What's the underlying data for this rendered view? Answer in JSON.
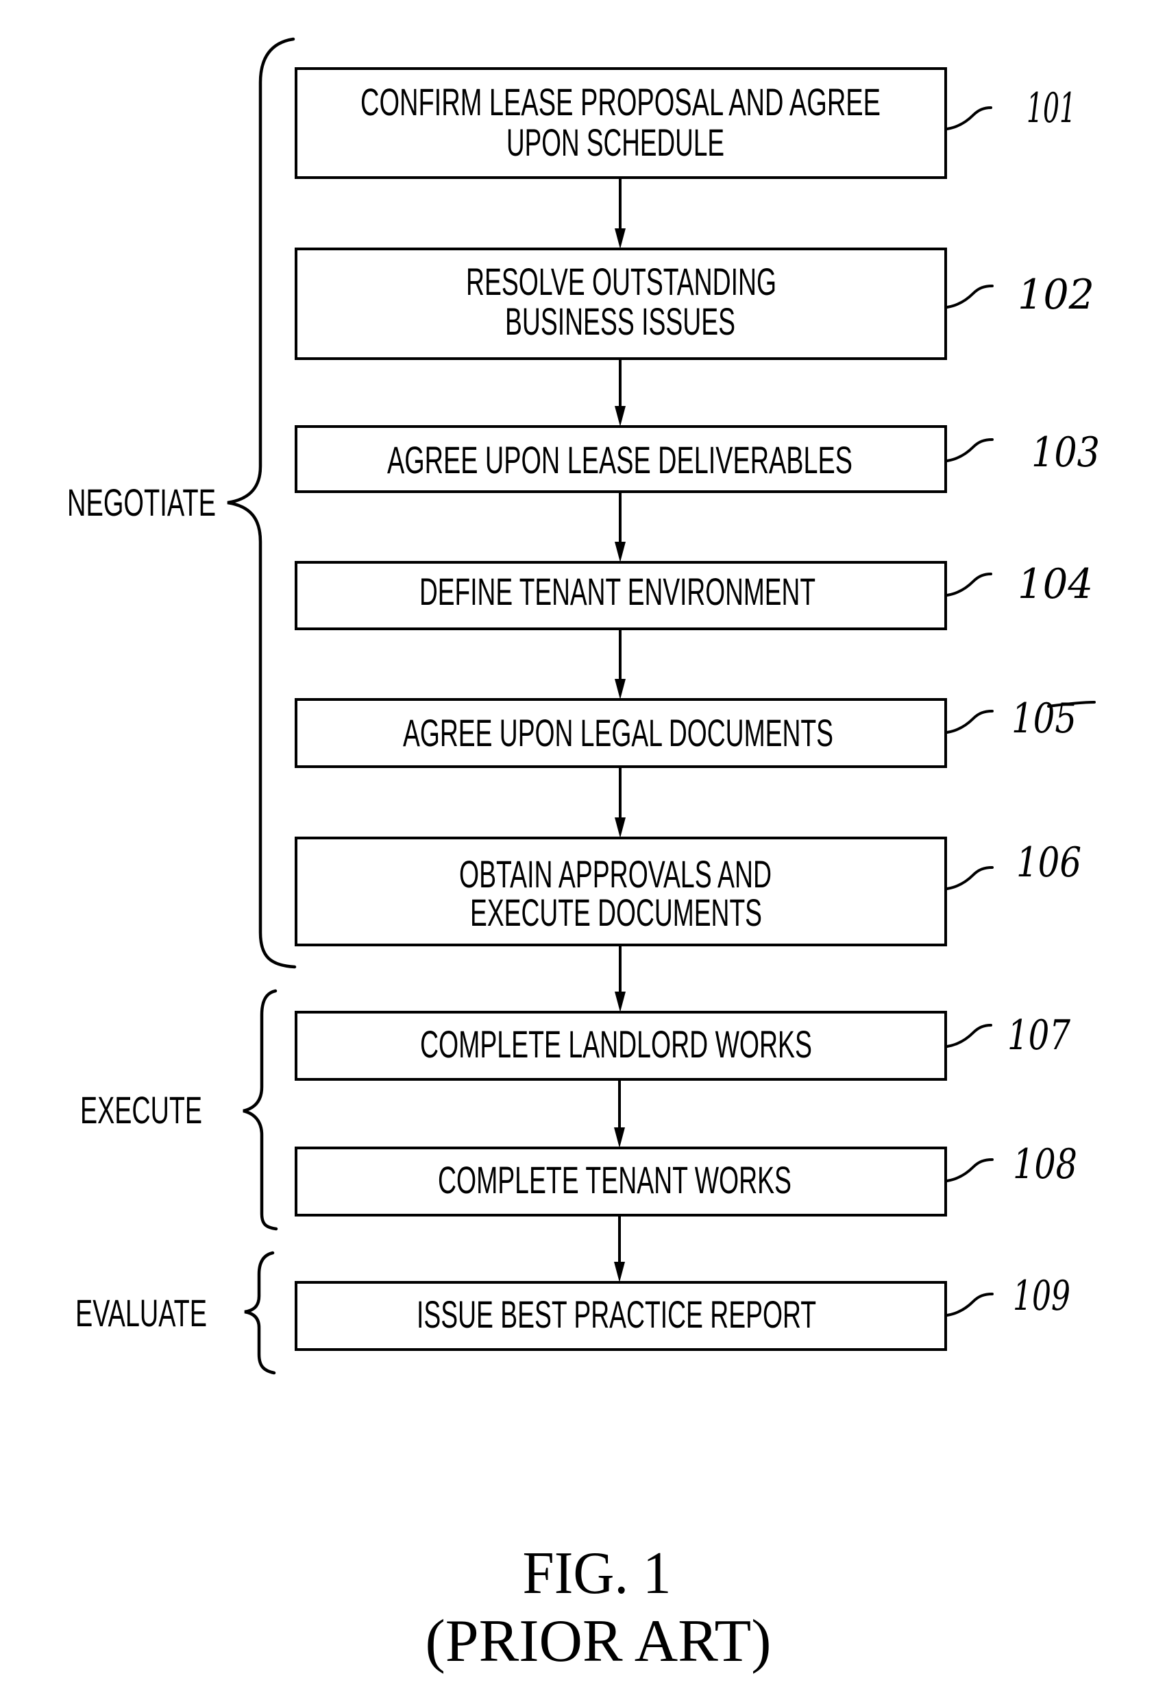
{
  "figure": {
    "caption": "FIG. 1",
    "subcaption": "(PRIOR ART)"
  },
  "phases": [
    {
      "label": "NEGOTIATE",
      "steps": [
        "101",
        "102",
        "103",
        "104",
        "105",
        "106"
      ]
    },
    {
      "label": "EXECUTE",
      "steps": [
        "107",
        "108"
      ]
    },
    {
      "label": "EVALUATE",
      "steps": [
        "109"
      ]
    }
  ],
  "steps": [
    {
      "ref": "101",
      "lines": [
        "CONFIRM LEASE PROPOSAL AND AGREE",
        "UPON SCHEDULE"
      ]
    },
    {
      "ref": "102",
      "lines": [
        "RESOLVE OUTSTANDING",
        "BUSINESS ISSUES"
      ]
    },
    {
      "ref": "103",
      "lines": [
        "AGREE UPON LEASE DELIVERABLES"
      ]
    },
    {
      "ref": "104",
      "lines": [
        "DEFINE TENANT ENVIRONMENT"
      ]
    },
    {
      "ref": "105",
      "lines": [
        "AGREE UPON LEGAL DOCUMENTS"
      ]
    },
    {
      "ref": "106",
      "lines": [
        "OBTAIN APPROVALS AND",
        "EXECUTE DOCUMENTS"
      ]
    },
    {
      "ref": "107",
      "lines": [
        "COMPLETE LANDLORD WORKS"
      ]
    },
    {
      "ref": "108",
      "lines": [
        "COMPLETE TENANT WORKS"
      ]
    },
    {
      "ref": "109",
      "lines": [
        "ISSUE BEST PRACTICE REPORT"
      ]
    }
  ],
  "connections": [
    {
      "from": "101",
      "to": "102"
    },
    {
      "from": "102",
      "to": "103"
    },
    {
      "from": "103",
      "to": "104"
    },
    {
      "from": "104",
      "to": "105"
    },
    {
      "from": "105",
      "to": "106"
    },
    {
      "from": "106",
      "to": "107"
    },
    {
      "from": "107",
      "to": "108"
    },
    {
      "from": "108",
      "to": "109"
    }
  ]
}
